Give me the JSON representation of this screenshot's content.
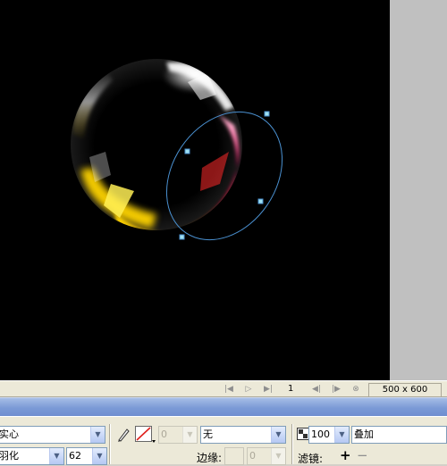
{
  "status_bar": {
    "frame_number": "1",
    "canvas_size": "500 x 600",
    "buttons": [
      "first-frame",
      "play",
      "last-frame",
      "prev-frame",
      "next-frame",
      "stop"
    ]
  },
  "properties": {
    "fill_type": "实心",
    "edge_type": "羽化",
    "edge_amount": "62",
    "stroke_size": "0",
    "stroke_type": "无",
    "edge_label": "边缘:",
    "edge_value": "0",
    "opacity": "100",
    "blend_mode": "叠加",
    "filters_label": "滤镜:",
    "add_filter": "+",
    "remove_filter": "−"
  },
  "colors": {
    "canvas": "#000000",
    "selection_path": "#4a90d0",
    "panel_header": "#7b9ad6",
    "panel_bg": "#ece9d8"
  },
  "icons": {
    "pencil": "pencil-icon",
    "no_stroke_swatch": "no-stroke-swatch-icon",
    "opacity": "opacity-icon"
  }
}
